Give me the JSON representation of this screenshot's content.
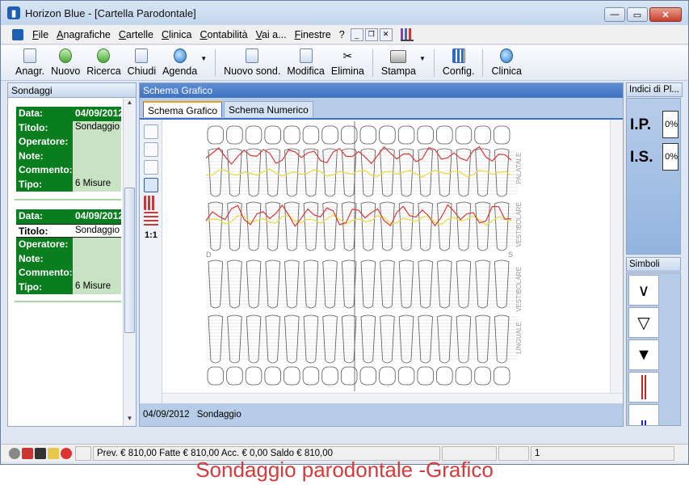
{
  "window": {
    "title": "Horizon Blue - [Cartella Parodontale]",
    "controls": [
      "—",
      "▭",
      "✕"
    ]
  },
  "menu": {
    "items": [
      "File",
      "Anagrafiche",
      "Cartelle",
      "Clinica",
      "Contabilità",
      "Vai a...",
      "Finestre",
      "?"
    ],
    "mdi_controls": [
      "_",
      "❐",
      "✕"
    ]
  },
  "toolbar": {
    "buttons": [
      {
        "label": "Anagr.",
        "icon": "document-icon"
      },
      {
        "label": "Nuovo",
        "icon": "new-person-icon"
      },
      {
        "label": "Ricerca",
        "icon": "search-icon"
      },
      {
        "label": "Chiudi",
        "icon": "close-folder-icon"
      },
      {
        "label": "Agenda",
        "icon": "agenda-icon"
      },
      {
        "label": "Nuovo sond.",
        "icon": "new-probe-icon"
      },
      {
        "label": "Modifica",
        "icon": "edit-icon"
      },
      {
        "label": "Elimina",
        "icon": "scissors-icon"
      },
      {
        "label": "Stampa",
        "icon": "printer-icon"
      },
      {
        "label": "Config.",
        "icon": "config-icon"
      },
      {
        "label": "Clinica",
        "icon": "clinic-icon"
      }
    ]
  },
  "left_panel": {
    "title": "Sondaggi",
    "cards": [
      {
        "date_label": "Data:",
        "date": "04/09/2012",
        "title_label": "Titolo:",
        "title": "Sondaggio",
        "operator_label": "Operatore:",
        "operator": "",
        "notes_label": "Note:",
        "notes": "",
        "comment_label": "Commento:",
        "comment": "",
        "type_label": "Tipo:",
        "type": "6 Misure"
      },
      {
        "date_label": "Data:",
        "date": "04/09/2012",
        "title_label": "Titolo:",
        "title": "Sondaggio",
        "operator_label": "Operatore:",
        "operator": "",
        "notes_label": "Note:",
        "notes": "",
        "comment_label": "Commento:",
        "comment": "",
        "type_label": "Tipo:",
        "type": "6 Misure"
      }
    ]
  },
  "center_panel": {
    "title": "Schema Grafico",
    "tabs": [
      "Schema Grafico",
      "Schema Numerico"
    ],
    "tool_label": "1:1",
    "side_labels": {
      "d": "D",
      "s": "S"
    },
    "section_labels": [
      "PALATALE",
      "VESTIBOLARE",
      "VESTIBOLARE",
      "LINGUALE"
    ],
    "footer_date": "04/09/2012",
    "footer_title": "Sondaggio"
  },
  "right_panel": {
    "indici_title": "Indici di Pl...",
    "ip_label": "I.P.",
    "ip_value": "0%",
    "is_label": "I.S.",
    "is_value": "0%",
    "simboli_title": "Simboli",
    "symbols": [
      "∨",
      "▽",
      "▼"
    ]
  },
  "status": {
    "prev": "Prev. € 810,00",
    "fatte": "Fatte € 810,00",
    "acc": "Acc. € 0,00",
    "saldo": "Saldo € 810,00",
    "page": "1"
  },
  "caption": "Sondaggio parodontale -Grafico",
  "colors": {
    "accent": "#3f71c0",
    "card_green": "#0a7d1f",
    "caption_red": "#d63a3a",
    "probe_line": "#d63a3a",
    "gum_line": "#e8e050"
  }
}
